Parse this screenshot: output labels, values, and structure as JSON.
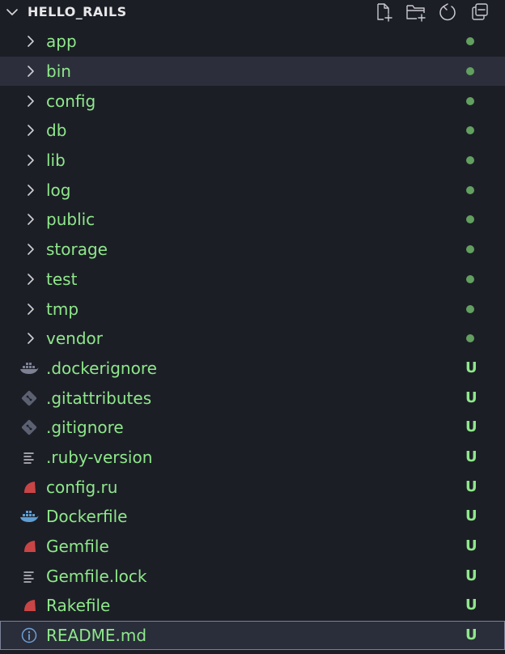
{
  "explorer": {
    "title": "HELLO_RAILS",
    "actions": [
      {
        "name": "new-file-icon"
      },
      {
        "name": "new-folder-icon"
      },
      {
        "name": "refresh-icon"
      },
      {
        "name": "collapse-all-icon"
      }
    ],
    "colors": {
      "background": "#1c1e26",
      "label": "#8ee88a",
      "dot": "#62a05f",
      "ruby": "#c94545",
      "docker": "#5f9ed1"
    },
    "items": [
      {
        "label": "app",
        "kind": "folder",
        "status": "dot"
      },
      {
        "label": "bin",
        "kind": "folder",
        "status": "dot"
      },
      {
        "label": "config",
        "kind": "folder",
        "status": "dot"
      },
      {
        "label": "db",
        "kind": "folder",
        "status": "dot"
      },
      {
        "label": "lib",
        "kind": "folder",
        "status": "dot"
      },
      {
        "label": "log",
        "kind": "folder",
        "status": "dot"
      },
      {
        "label": "public",
        "kind": "folder",
        "status": "dot"
      },
      {
        "label": "storage",
        "kind": "folder",
        "status": "dot"
      },
      {
        "label": "test",
        "kind": "folder",
        "status": "dot"
      },
      {
        "label": "tmp",
        "kind": "folder",
        "status": "dot"
      },
      {
        "label": "vendor",
        "kind": "folder",
        "status": "dot"
      },
      {
        "label": ".dockerignore",
        "kind": "file",
        "icon": "docker-muted-icon",
        "status": "U"
      },
      {
        "label": ".gitattributes",
        "kind": "file",
        "icon": "git-icon",
        "status": "U"
      },
      {
        "label": ".gitignore",
        "kind": "file",
        "icon": "git-icon",
        "status": "U"
      },
      {
        "label": ".ruby-version",
        "kind": "file",
        "icon": "text-lines-icon",
        "status": "U"
      },
      {
        "label": "config.ru",
        "kind": "file",
        "icon": "ruby-icon",
        "status": "U"
      },
      {
        "label": "Dockerfile",
        "kind": "file",
        "icon": "docker-icon",
        "status": "U"
      },
      {
        "label": "Gemfile",
        "kind": "file",
        "icon": "ruby-icon",
        "status": "U"
      },
      {
        "label": "Gemfile.lock",
        "kind": "file",
        "icon": "text-lines-icon",
        "status": "U"
      },
      {
        "label": "Rakefile",
        "kind": "file",
        "icon": "ruby-icon",
        "status": "U"
      },
      {
        "label": "README.md",
        "kind": "file",
        "icon": "info-icon",
        "status": "U"
      }
    ],
    "hovered_item": "bin",
    "selected_item": "README.md"
  }
}
